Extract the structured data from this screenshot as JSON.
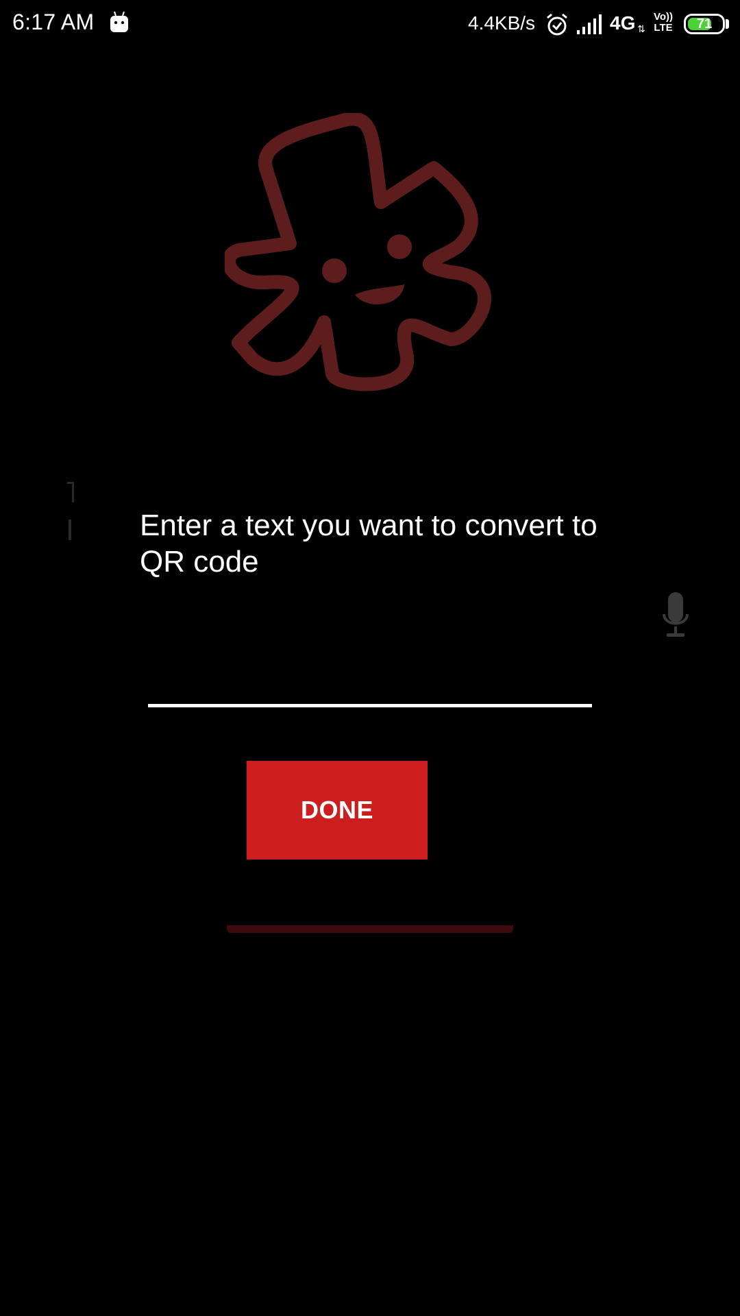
{
  "status_bar": {
    "time": "6:17 AM",
    "network_speed": "4.4KB/s",
    "network_type": "4G",
    "network_arrows": "⇅",
    "volte_line1": "Vo))",
    "volte_line2": "LTE",
    "battery_level": "71",
    "battery_fraction": 0.71,
    "battery_color": "#4cd137",
    "icons": [
      "android-notification-icon",
      "alarm-icon",
      "signal-icon"
    ]
  },
  "dialog": {
    "prompt": "Enter a text you want to convert to QR code",
    "input_value": "",
    "input_placeholder": "",
    "done_label": "DONE"
  },
  "background": {
    "mascot_icon": "mascot-flower-logo",
    "mic_icon": "microphone-icon"
  },
  "colors": {
    "accent": "#cc1e1e",
    "mascot": "#5e1d1d",
    "background": "#000000"
  }
}
